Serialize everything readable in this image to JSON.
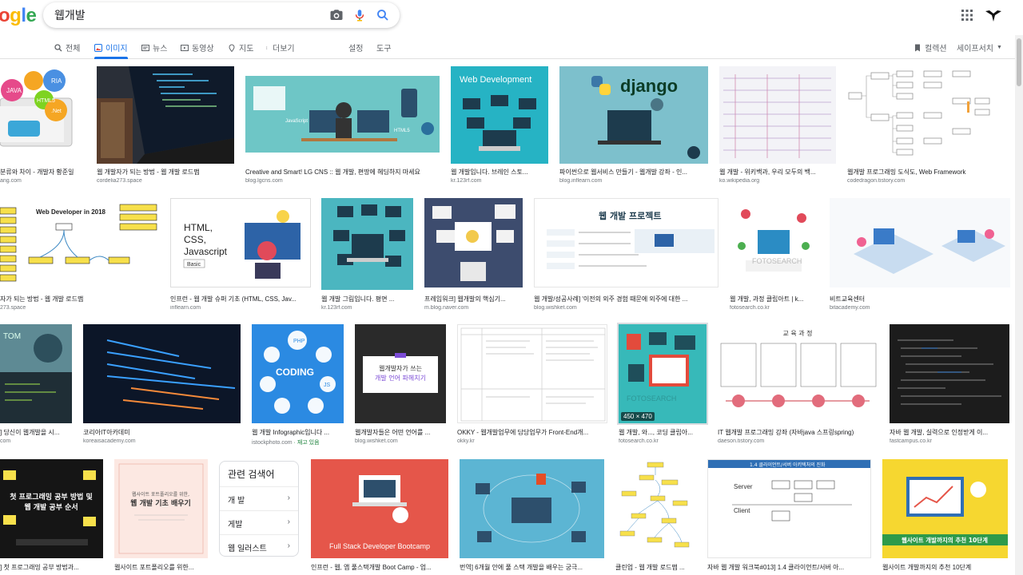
{
  "brand": {
    "logo_text": "ogle",
    "colors": [
      "#EA4335",
      "#FBBC05",
      "#4285F4",
      "#34A853",
      "#EA4335"
    ]
  },
  "search": {
    "query": "웹개발",
    "icons": [
      "camera-icon",
      "microphone-icon",
      "search-icon"
    ]
  },
  "header_right": {
    "icons": [
      "apps-grid-icon",
      "account-avatar-icon"
    ]
  },
  "tabs": [
    {
      "label": "전체",
      "icon": "search-icon"
    },
    {
      "label": "이미지",
      "icon": "image-icon",
      "active": true
    },
    {
      "label": "뉴스",
      "icon": "news-icon"
    },
    {
      "label": "동영상",
      "icon": "video-icon"
    },
    {
      "label": "지도",
      "icon": "map-pin-icon"
    },
    {
      "label": "더보기",
      "icon": "more-vert-icon"
    },
    {
      "label": "설정"
    },
    {
      "label": "도구"
    }
  ],
  "tabs_right": {
    "collections": "컬렉션",
    "safesearch": "세이프서치"
  },
  "rows": [
    [
      {
        "caption": "분류와 차이 - 개발자 황준일",
        "source": "ang.com"
      },
      {
        "caption": "웹 개발자가 되는 방법 - 웹 개발 로드맵",
        "source": "cordelia273.space"
      },
      {
        "caption": "Creative and Smart! LG CNS :: 웹 개발, 편땅에 헤딩하지 마세요",
        "source": "blog.lgcns.com"
      },
      {
        "caption": "웹 개발입니다. 브레인 스토...",
        "source": "kr.123rf.com",
        "image_text": "Web Development"
      },
      {
        "caption": "파이썬으로 웹서비스 만들기 - 웹개발 강좌 - 인...",
        "source": "blog.inflearn.com",
        "image_text": "django"
      },
      {
        "caption": "웹 개발 - 위키백과, 우리 모두의 백...",
        "source": "ko.wikipedia.org"
      },
      {
        "caption": "웹개발 프로그래밍 도식도, Web Framework",
        "source": "codedragon.tistory.com"
      }
    ],
    [
      {
        "caption": "자가 되는 방법 - 웹 개발 로드맵",
        "source": "273.space",
        "image_text": "Web Developer in 2018"
      },
      {
        "caption": "인프런 - 웹 개발 슈퍼 기초 (HTML, CSS, Jav...",
        "source": "inflearn.com",
        "image_text": "HTML,\nCSS,\nJavascript",
        "image_badge": "Basic"
      },
      {
        "caption": "웹 개발 그림입니다. 평면 ...",
        "source": "kr.123rf.com"
      },
      {
        "caption": "프레임워크] 웹개발의 핵심기...",
        "source": "m.blog.naver.com"
      },
      {
        "caption": "웹 개발/성공사례] '이전의 외주 경험 때문에 외주에 대한 ...",
        "source": "blog.wishket.com",
        "image_text": "웹 개발 프로젝트"
      },
      {
        "caption": "웹 개발, 과정 클립아트 | k...",
        "source": "fotosearch.co.kr",
        "image_text": "FOTOSEARCH"
      },
      {
        "caption": "비트교육센터",
        "source": "bitacademy.com"
      }
    ],
    [
      {
        "caption": "] 당신이 웹개발을 시...",
        "source": "com",
        "image_text": "TOM"
      },
      {
        "caption": "코리아IT아카데미",
        "source": "koreaisacademy.com"
      },
      {
        "caption": "웹 개발 Infographic입니다 ...",
        "source": "istockphoto.com",
        "source_extra": "· 재고 있음",
        "image_text": "CODING"
      },
      {
        "caption": "웹개발자들은 어떤 언어를 ...",
        "source": "blog.wishket.com",
        "image_text": "웹개발자가 쓰는\n개발 언어 파헤치기"
      },
      {
        "caption": "OKKY - 웹개발업무에 담당업무가 Front-End개...",
        "source": "okky.kr"
      },
      {
        "caption": "웹 개발, 와..., 코딩 클립아...",
        "source": "fotosearch.co.kr",
        "image_text": "FOTOSEARCH",
        "dims": "450 × 470"
      },
      {
        "caption": "IT 웹개발 프로그래밍 강좌 (자바java 스프링spring)",
        "source": "daeson.tistory.com",
        "image_text": "교 육 과 정"
      },
      {
        "caption": "자바 웹 개발, 실력으로 인정받게 이...",
        "source": "fastcampus.co.kr"
      }
    ],
    [
      {
        "caption": "] 첫 프로그래밍 공부 방법과...",
        "image_text": "첫 프로그래밍 공부 방법 및\n웹 개발 공부 순서"
      },
      {
        "caption": "웹사이트 포트폴리오를 위한...",
        "image_text": "웹사이트 포트폴리오를 위한,\n웹 개발 기초 배우기"
      },
      {
        "caption": "인프런 - 웹, 앱 풀스택개발 Boot Camp - 업...",
        "image_text": "Full Stack Developer Bootcamp"
      },
      {
        "caption": "번역] 6개월 안에 풀 스택 개발을 배우는 궁극..."
      },
      {
        "caption": "클린업 - 웹 개발 로드맵 ..."
      },
      {
        "caption": "자바 웹 개발 워크북#013] 1.4 클라이언트/서버 아...",
        "image_text": "1.4 클라이언트/서버 아키텍처의 진화",
        "image_sub": "Server\nClient"
      },
      {
        "caption": "웹사이트 개발까지의 추천 10단계",
        "image_text": "웹사이트 개발까지의 추천 10단계"
      }
    ]
  ],
  "related": {
    "title": "관련 검색어",
    "items": [
      "개 발",
      "게발",
      "웹 일러스트"
    ]
  }
}
